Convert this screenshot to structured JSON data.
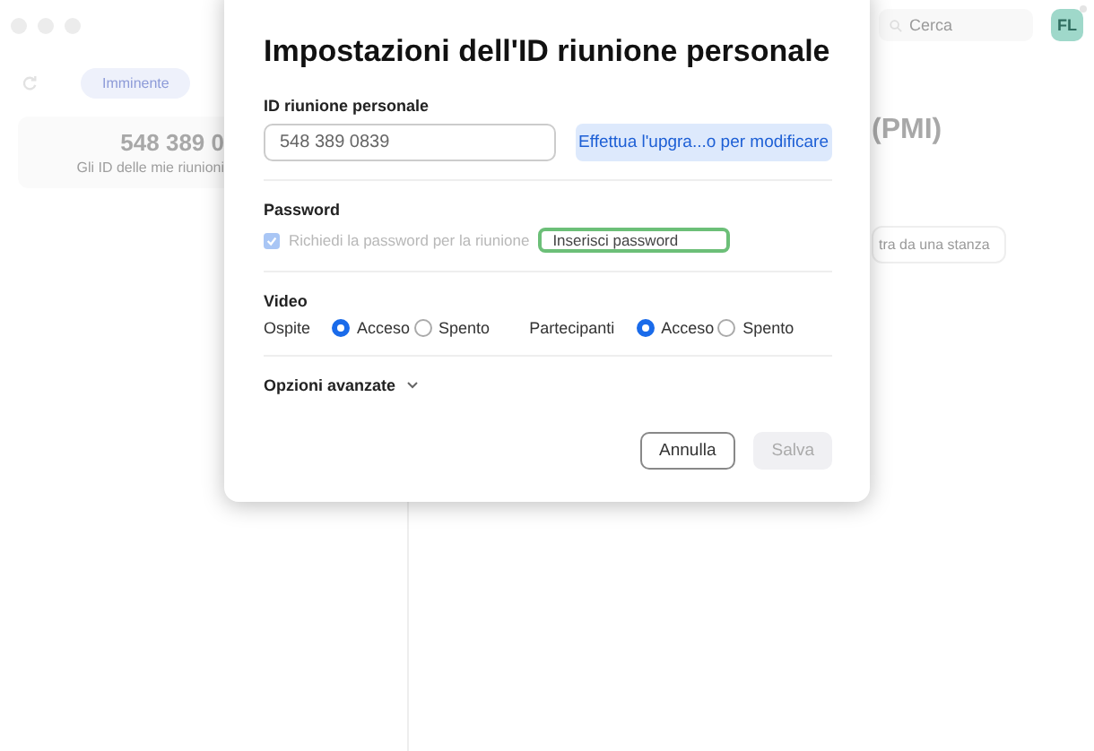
{
  "background": {
    "tabs": [
      {
        "label": "Imminente",
        "selected": true
      }
    ],
    "meeting_card": {
      "id": "548 389 0",
      "caption": "Gli ID delle mie riunioni"
    },
    "search": {
      "placeholder": "Cerca"
    },
    "avatar": {
      "initials": "FL"
    },
    "heading": "(PMI)",
    "room_button": "tra da una stanza"
  },
  "dialog": {
    "title": "Impostazioni dell'ID riunione personale",
    "personal_id": {
      "label": "ID riunione personale",
      "value": "548 389 0839",
      "upgrade_button": "Effettua l'upgra...o per modificare"
    },
    "password": {
      "label": "Password",
      "require": {
        "label": "Richiedi la password per la riunione",
        "checked": true,
        "disabled": true
      },
      "field": {
        "placeholder": "Inserisci password"
      }
    },
    "video": {
      "label": "Video",
      "groups": [
        {
          "label": "Ospite",
          "options": [
            {
              "label": "Acceso",
              "selected": true
            },
            {
              "label": "Spento",
              "selected": false
            }
          ]
        },
        {
          "label": "Partecipanti",
          "options": [
            {
              "label": "Acceso",
              "selected": true
            },
            {
              "label": "Spento",
              "selected": false
            }
          ]
        }
      ]
    },
    "advanced": {
      "label": "Opzioni avanzate",
      "expanded": false
    },
    "buttons": [
      {
        "label": "Annulla",
        "kind": "secondary",
        "disabled": false
      },
      {
        "label": "Salva",
        "kind": "primary",
        "disabled": true
      }
    ]
  }
}
